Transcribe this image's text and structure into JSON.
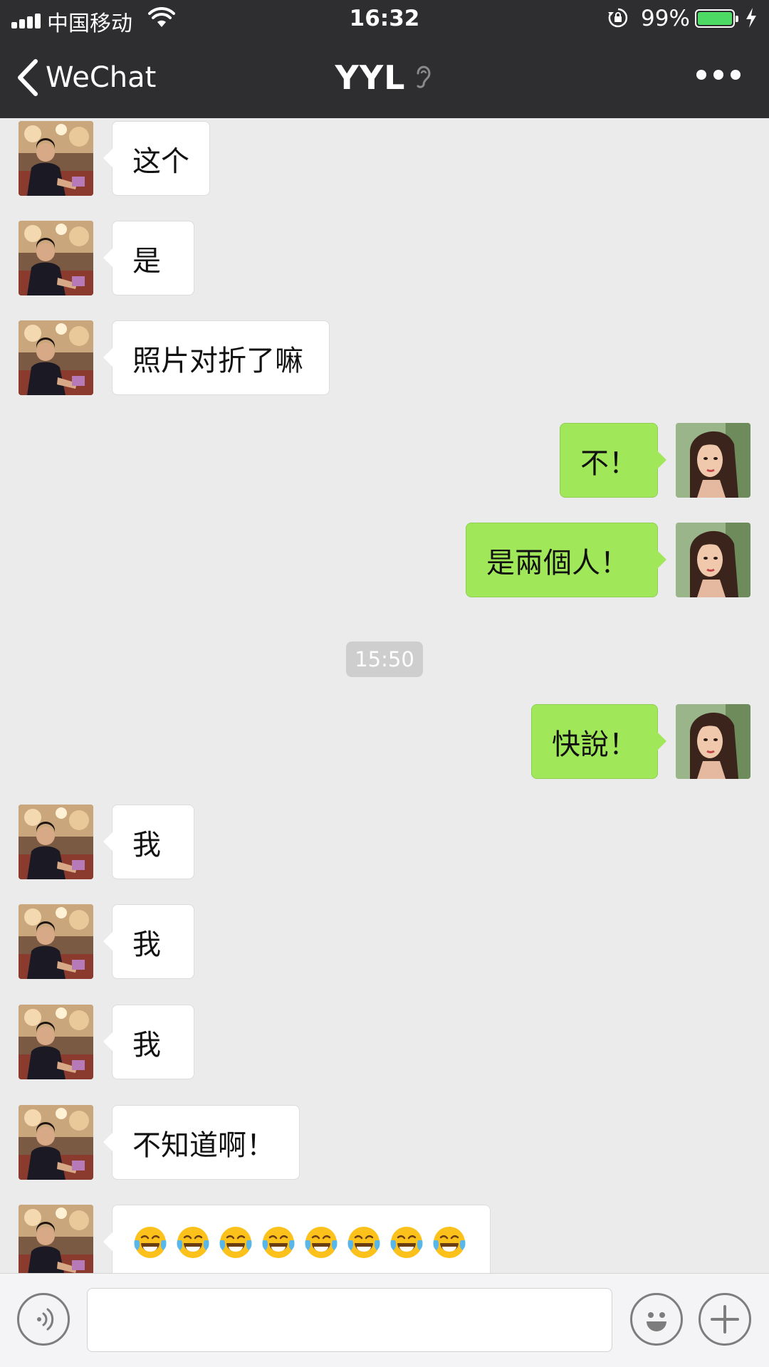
{
  "status_bar": {
    "carrier": "中国移动",
    "time": "16:32",
    "battery_percent": "99%",
    "battery_level": 0.99,
    "icons": [
      "signal-icon",
      "wifi-icon",
      "rotation-lock-icon",
      "battery-icon",
      "charging-icon"
    ]
  },
  "nav": {
    "back_label": "WeChat",
    "title": "YYL",
    "icons": [
      "back-chevron-icon",
      "earpiece-mode-icon",
      "more-icon"
    ]
  },
  "messages": [
    {
      "side": "left",
      "text": "这个"
    },
    {
      "side": "left",
      "text": "是"
    },
    {
      "side": "left",
      "text": "照片对折了嘛"
    },
    {
      "side": "right",
      "text": "不！"
    },
    {
      "side": "right",
      "text": "是兩個人！"
    },
    {
      "side": "right",
      "text": "快說！"
    },
    {
      "side": "left",
      "text": "我"
    },
    {
      "side": "left",
      "text": "我"
    },
    {
      "side": "left",
      "text": "我"
    },
    {
      "side": "left",
      "text": "不知道啊！"
    },
    {
      "side": "left",
      "text": "",
      "emoji_count": 8,
      "emoji_name": "tears-of-joy-emoji"
    }
  ],
  "timestamp": "15:50",
  "input_bar": {
    "value": "",
    "icons": [
      "voice-icon",
      "emoji-icon",
      "plus-icon"
    ]
  },
  "colors": {
    "nav_bg": "#2e2e30",
    "chat_bg": "#ebebeb",
    "sent_bubble": "#a0e75a",
    "received_bubble": "#ffffff",
    "battery_fill": "#4cd964"
  }
}
